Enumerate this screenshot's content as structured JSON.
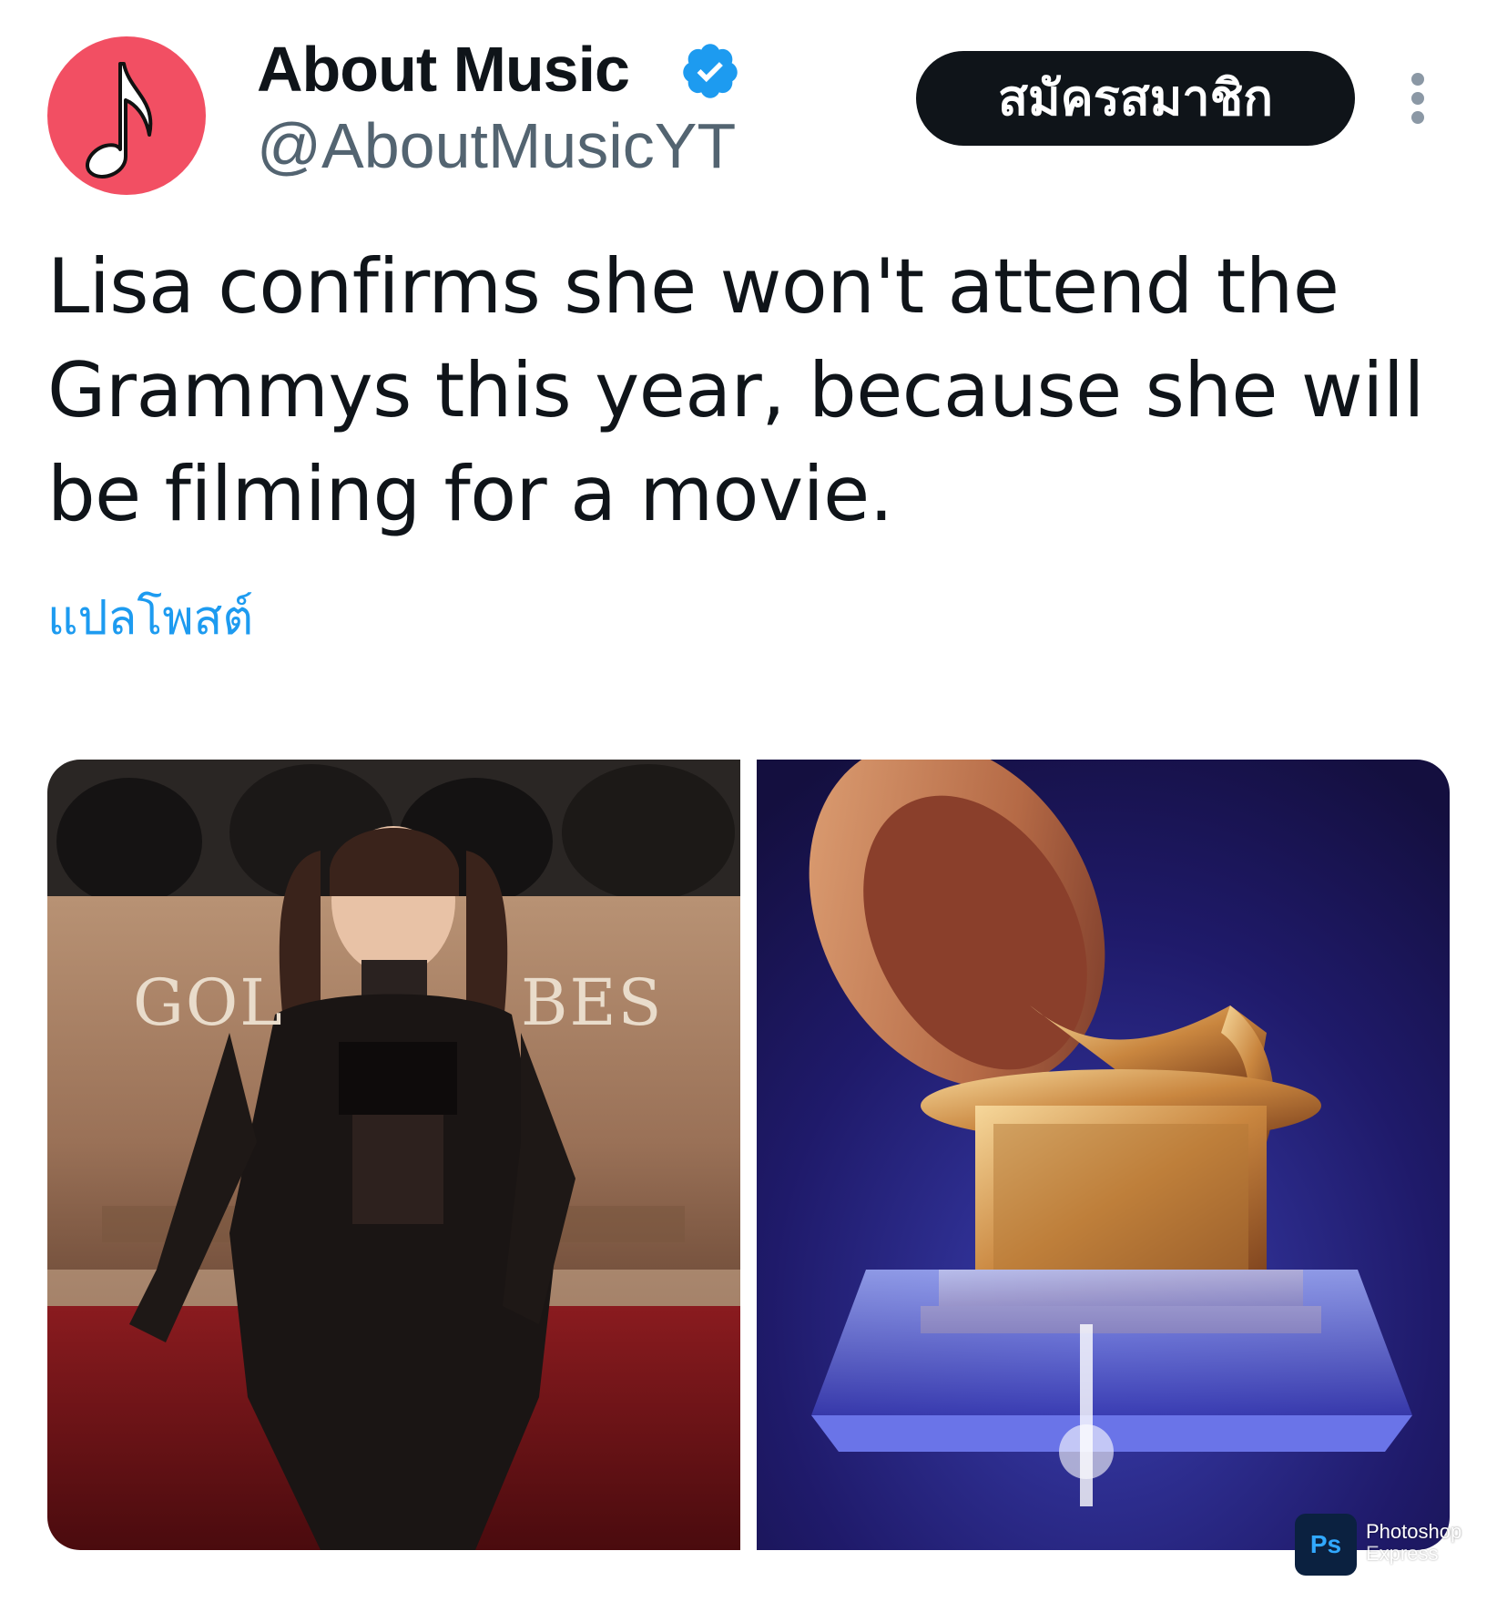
{
  "author": {
    "display_name": "About Music",
    "handle": "@AboutMusicYT",
    "avatar_icon": "music-note-icon",
    "avatar_color": "#f24f63",
    "verified": true
  },
  "actions": {
    "subscribe_label": "สมัครสมาชิก",
    "more_icon": "more-vertical-icon"
  },
  "tweet": {
    "text": "Lisa confirms she won't attend the Grammys this year, because she will be filming for a movie.",
    "translate_label": "แปลโพสต์"
  },
  "media": {
    "left_image_text_a": "GOL",
    "left_image_text_b": "BES"
  },
  "watermark": {
    "icon_label": "Ps",
    "line1": "Photoshop",
    "line2": "Express"
  },
  "colors": {
    "text": "#0f1419",
    "secondary": "#536471",
    "link": "#1d9bf0",
    "verified": "#1d9bf0"
  }
}
